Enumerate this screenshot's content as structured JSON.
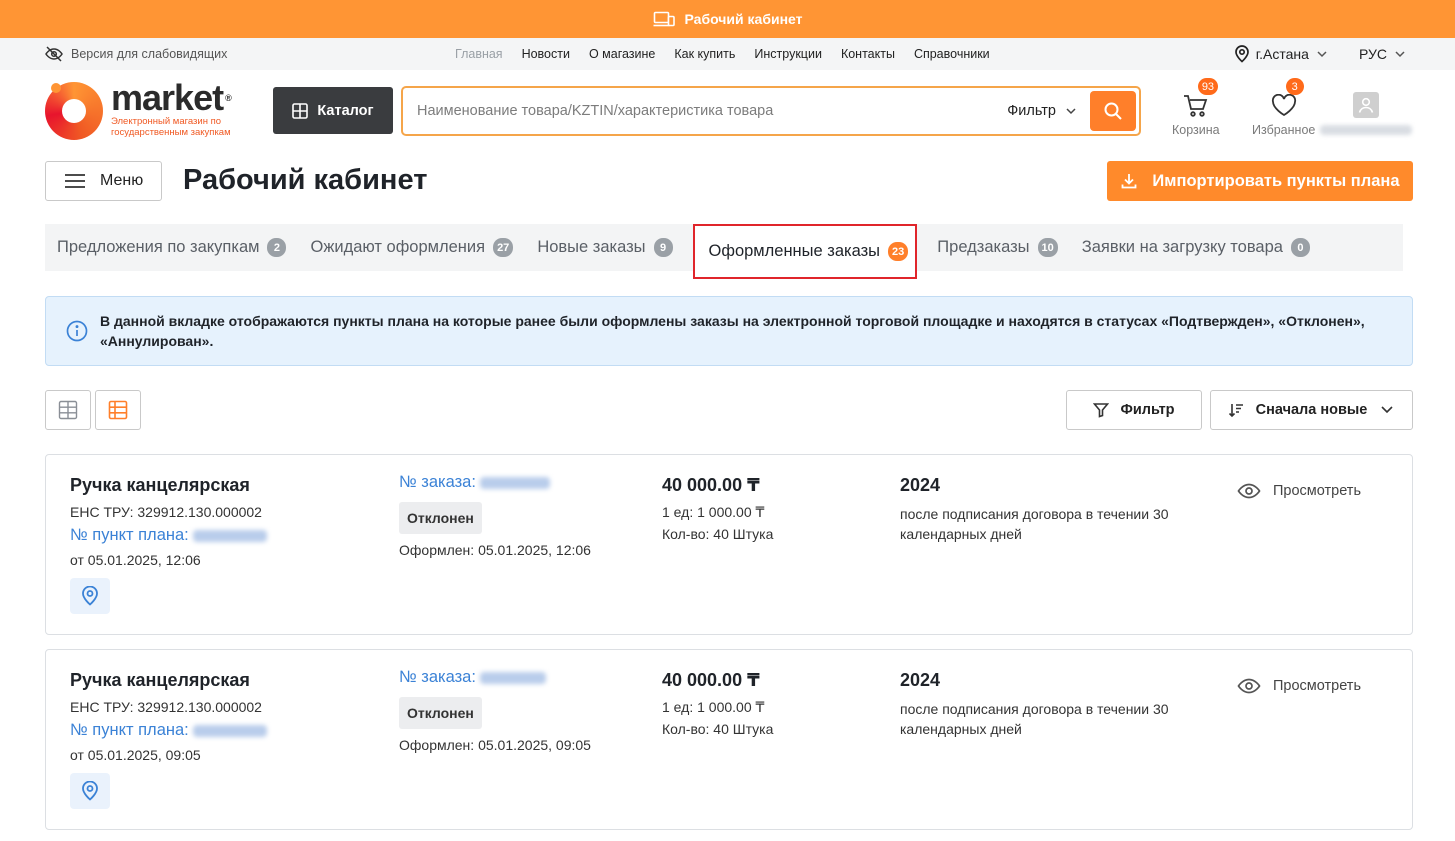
{
  "topbar": {
    "title": "Рабочий кабинет",
    "icon": "devices-icon"
  },
  "subnav": {
    "accessibility": "Версия для слабовидящих",
    "links": [
      {
        "label": "Главная",
        "muted": true
      },
      {
        "label": "Новости"
      },
      {
        "label": "О магазине"
      },
      {
        "label": "Как купить"
      },
      {
        "label": "Инструкции"
      },
      {
        "label": "Контакты"
      },
      {
        "label": "Справочники"
      }
    ],
    "city": "г.Астана",
    "language": "РУС"
  },
  "header": {
    "logo_word": "market",
    "logo_mark": "®",
    "logo_slogan": "Электронный магазин по государственным закупкам",
    "catalog_label": "Каталог",
    "search_placeholder": "Наименование товара/KZTIN/характеристика товара",
    "search_filter": "Фильтр",
    "cart": {
      "label": "Корзина",
      "count": "93"
    },
    "favorites": {
      "label": "Избранное",
      "count": "3"
    }
  },
  "page": {
    "menu_label": "Меню",
    "title": "Рабочий кабинет",
    "import_label": "Импортировать пункты плана"
  },
  "tabs": [
    {
      "label": "Предложения по закупкам",
      "count": "2"
    },
    {
      "label": "Ожидают оформления",
      "count": "27"
    },
    {
      "label": "Новые заказы",
      "count": "9"
    },
    {
      "label": "Оформленные заказы",
      "count": "23",
      "active": true
    },
    {
      "label": "Предзаказы",
      "count": "10"
    },
    {
      "label": "Заявки на загрузку товара",
      "count": "0"
    }
  ],
  "info": "В данной вкладке отображаются пункты плана на которые ранее были оформлены заказы на электронной торговой площадке и находятся в статусах «Подтвержден», «Отклонен», «Аннулирован».",
  "toolbar": {
    "filter_label": "Фильтр",
    "sort_label": "Сначала новые"
  },
  "orders": [
    {
      "name": "Ручка канцелярская",
      "ens": "ЕНС ТРУ: 329912.130.000002",
      "plan_label": "№ пункт плана:",
      "plan_date": "от 05.01.2025, 12:06",
      "order_label": "№ заказа:",
      "status": "Отклонен",
      "formed": "Оформлен: 05.01.2025, 12:06",
      "price": "40 000.00 ₸",
      "unit_price": "1 ед: 1 000.00 ₸",
      "qty": "Кол-во: 40 Штука",
      "year": "2024",
      "term": "после подписания договора в течении 30 календарных дней",
      "view_label": "Просмотреть"
    },
    {
      "name": "Ручка канцелярская",
      "ens": "ЕНС ТРУ: 329912.130.000002",
      "plan_label": "№ пункт плана:",
      "plan_date": "от 05.01.2025, 09:05",
      "order_label": "№ заказа:",
      "status": "Отклонен",
      "formed": "Оформлен: 05.01.2025, 09:05",
      "price": "40 000.00 ₸",
      "unit_price": "1 ед: 1 000.00 ₸",
      "qty": "Кол-во: 40 Штука",
      "year": "2024",
      "term": "после подписания договора в течении 30 календарных дней",
      "view_label": "Просмотреть"
    }
  ],
  "colors": {
    "accent": "#ff9534",
    "link": "#3b82d6",
    "active_tab_border": "#e0252b",
    "info_bg": "#e6f2fd"
  }
}
